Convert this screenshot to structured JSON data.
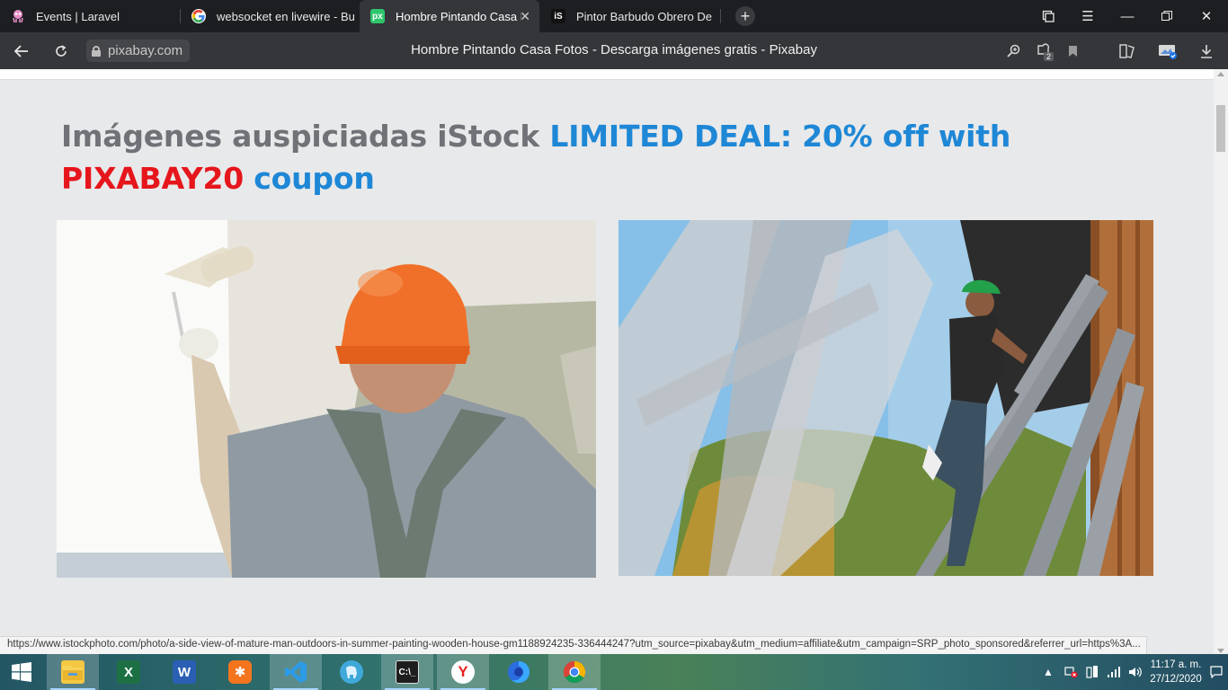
{
  "tabs": [
    {
      "title": "Events | Laravel",
      "favicon": "laravel-octopus-icon",
      "active": false
    },
    {
      "title": "websocket en livewire - Bu",
      "favicon": "google-g-icon",
      "active": false
    },
    {
      "title": "Hombre Pintando Casa F",
      "favicon": "pixabay-icon",
      "favicon_text": "px",
      "active": true
    },
    {
      "title": "Pintor Barbudo Obrero De",
      "favicon": "istock-icon",
      "favicon_text": "iS",
      "active": false
    }
  ],
  "address_bar": {
    "url": "pixabay.com",
    "page_title": "Hombre Pintando Casa Fotos - Descarga imágenes gratis - Pixabay",
    "extensions_badge": "2"
  },
  "content": {
    "heading_lead": "Imágenes auspiciadas iStock",
    "heading_deal": "LIMITED DEAL: 20% off with",
    "heading_code": "PIXABAY20",
    "heading_tail": "coupon",
    "photos": [
      {
        "subject": "worker in orange hard hat painting wall with roller"
      },
      {
        "subject": "man on ladder painting wooden house"
      }
    ]
  },
  "status_url": "https://www.istockphoto.com/photo/a-side-view-of-mature-man-outdoors-in-summer-painting-wooden-house-gm1188924235-336444247?utm_source=pixabay&utm_medium=affiliate&utm_campaign=SRP_photo_sponsored&referrer_url=https%3A...",
  "taskbar": {
    "apps": [
      "windows-start-icon",
      "file-explorer-icon",
      "excel-icon",
      "word-icon",
      "xampp-icon",
      "vscode-icon",
      "elephant-app-icon",
      "terminal-icon",
      "yandex-browser-icon",
      "firefox-icon",
      "chrome-icon"
    ],
    "time": "11:17 a. m.",
    "date": "27/12/2020"
  },
  "colors": {
    "deal_blue": "#1e87d6",
    "coupon_red": "#e5161c",
    "heading_gray": "#6f7276",
    "browser_dark": "#35363a"
  }
}
